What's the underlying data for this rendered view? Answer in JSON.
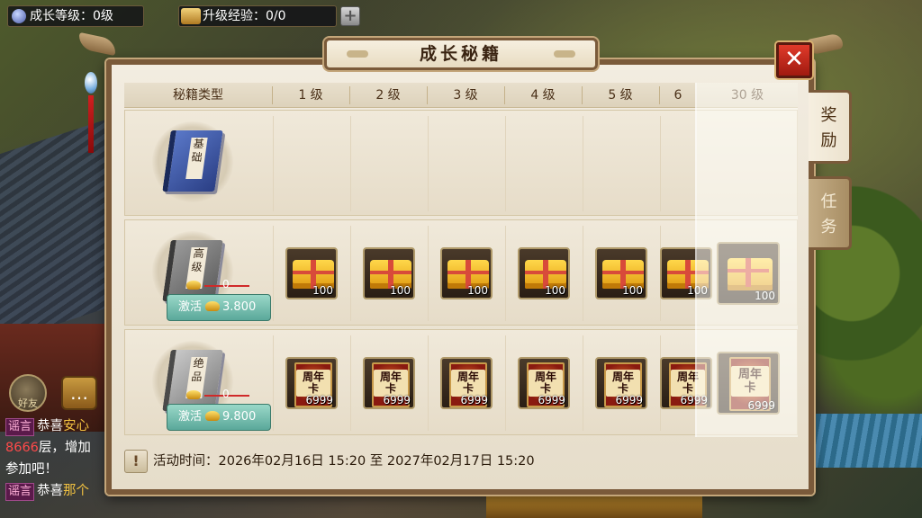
{
  "hud": {
    "growth_level": "成长等级：0级",
    "upgrade_exp": "升级经验：0/0",
    "plus": "+",
    "exp_icon_text": "经验"
  },
  "side": {
    "friend_label": "好友",
    "chat_lines": [
      {
        "tag": "谣言",
        "pre": "恭喜",
        "hl": "安心"
      },
      {
        "red": "8666",
        "text": "层，增加"
      },
      {
        "text": "参加吧！"
      },
      {
        "tag": "谣言",
        "pre": "恭喜",
        "hl": "那个"
      }
    ]
  },
  "panel": {
    "title": "成长秘籍",
    "close": "✕",
    "tabs": [
      {
        "label_top": "奖",
        "label_bottom": "励",
        "active": true
      },
      {
        "label_top": "任",
        "label_bottom": "务",
        "active": false
      }
    ],
    "headers": [
      "秘籍类型",
      "1 级",
      "2 级",
      "3 级",
      "4 级",
      "5 级",
      "6",
      "30 级"
    ],
    "rows": [
      {
        "book_label": "基础",
        "book_color": "blue",
        "has_activate": false,
        "rewards": []
      },
      {
        "book_label": "高级",
        "book_color": "grey1",
        "has_activate": true,
        "old_price": "0",
        "activate_label": "激活",
        "price": "3.800",
        "reward_type": "chest",
        "rewards": [
          "100",
          "100",
          "100",
          "100",
          "100",
          "100",
          "100"
        ]
      },
      {
        "book_label": "绝品",
        "book_color": "grey2",
        "has_activate": true,
        "old_price": "0",
        "activate_label": "激活",
        "price": "9.800",
        "reward_type": "card",
        "card_text": "周年卡",
        "rewards": [
          "6999",
          "6999",
          "6999",
          "6999",
          "6999",
          "6999",
          "6999"
        ]
      }
    ],
    "footer_warn": "!",
    "activity_time": "活动时间：2026年02月16日 15:20 至 2027年02月17日 15:20"
  },
  "colors": {
    "frame": "#7a5a3a",
    "panel_bg": "#f2ece0",
    "close_red": "#e03a2a",
    "activate_teal": "#5aa89a"
  }
}
